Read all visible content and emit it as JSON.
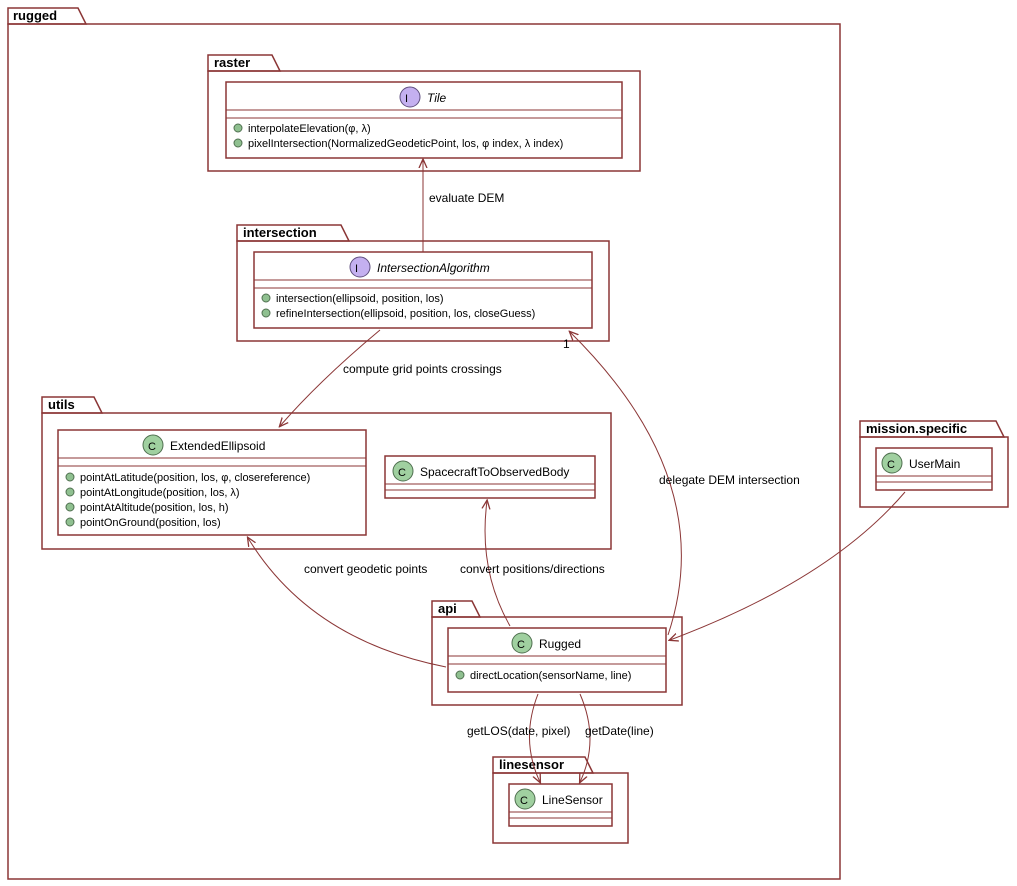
{
  "packages": {
    "rugged": {
      "label": "rugged"
    },
    "raster": {
      "label": "raster"
    },
    "intersection": {
      "label": "intersection"
    },
    "utils": {
      "label": "utils"
    },
    "api": {
      "label": "api"
    },
    "linesensor": {
      "label": "linesensor"
    },
    "mission_specific": {
      "label": "mission.specific"
    }
  },
  "classes": {
    "tile": {
      "name": "Tile",
      "stereotype": "I",
      "members": [
        "interpolateElevation(φ, λ)",
        "pixelIntersection(NormalizedGeodeticPoint, los, φ index, λ index)"
      ]
    },
    "intersection_alg": {
      "name": "IntersectionAlgorithm",
      "stereotype": "I",
      "members": [
        "intersection(ellipsoid, position, los)",
        "refineIntersection(ellipsoid, position, los, closeGuess)"
      ]
    },
    "extended_ellipsoid": {
      "name": "ExtendedEllipsoid",
      "stereotype": "C",
      "members": [
        "pointAtLatitude(position, los, φ, closereference)",
        "pointAtLongitude(position, los, λ)",
        "pointAtAltitude(position, los, h)",
        "pointOnGround(position, los)"
      ]
    },
    "sc_to_body": {
      "name": "SpacecraftToObservedBody",
      "stereotype": "C",
      "members": []
    },
    "rugged": {
      "name": "Rugged",
      "stereotype": "C",
      "members": [
        "directLocation(sensorName, line)"
      ]
    },
    "line_sensor": {
      "name": "LineSensor",
      "stereotype": "C",
      "members": []
    },
    "user_main": {
      "name": "UserMain",
      "stereotype": "C",
      "members": []
    }
  },
  "relations": {
    "evaluate_dem": "evaluate DEM",
    "compute_crossings": "compute grid points crossings",
    "delegate_dem": "delegate DEM intersection",
    "convert_geodetic": "convert geodetic points",
    "convert_pos_dir": "convert positions/directions",
    "get_los": "getLOS(date, pixel)",
    "get_date": "getDate(line)",
    "multiplicity_1": "1"
  }
}
